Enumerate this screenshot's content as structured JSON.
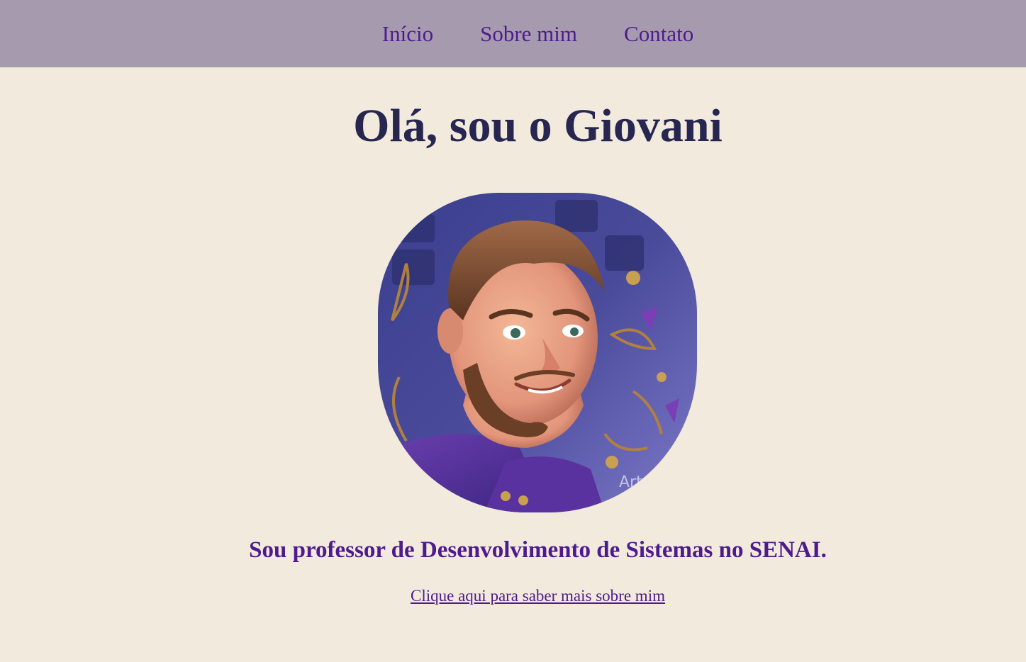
{
  "nav": {
    "items": [
      {
        "label": "Início"
      },
      {
        "label": "Sobre mim"
      },
      {
        "label": "Contato"
      }
    ]
  },
  "hero": {
    "title": "Olá, sou o Giovani"
  },
  "profile": {
    "watermark": "Art"
  },
  "bio": {
    "text": "Sou professor de Desenvolvimento de Sistemas no SENAI."
  },
  "link": {
    "label": "Clique aqui para saber mais sobre mim"
  },
  "colors": {
    "nav_bg": "#a69bae",
    "page_bg": "#f2eadd",
    "accent": "#4d1b8e",
    "title": "#262650"
  }
}
